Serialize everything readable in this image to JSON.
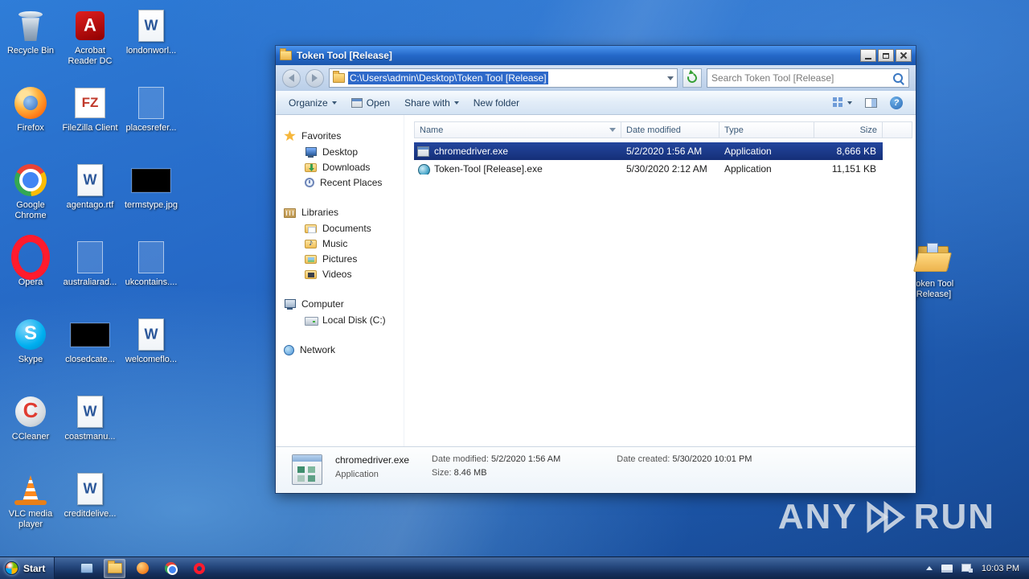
{
  "colors": {
    "selection": "#152f78",
    "titlebar": "#2468c8",
    "taskbar": "#1c3a6b",
    "desktop": "#1f5fb8"
  },
  "desktop": {
    "columns": [
      {
        "items": [
          {
            "label": "Recycle Bin",
            "icon": "recycle-bin"
          },
          {
            "label": "Firefox",
            "icon": "firefox"
          },
          {
            "label": "Google Chrome",
            "icon": "chrome"
          },
          {
            "label": "Opera",
            "icon": "opera"
          },
          {
            "label": "Skype",
            "icon": "skype"
          },
          {
            "label": "CCleaner",
            "icon": "ccleaner"
          },
          {
            "label": "VLC media player",
            "icon": "vlc"
          }
        ]
      },
      {
        "items": [
          {
            "label": "Acrobat Reader DC",
            "icon": "acrobat"
          },
          {
            "label": "FileZilla Client",
            "icon": "filezilla"
          },
          {
            "label": "agentago.rtf",
            "icon": "word-doc"
          },
          {
            "label": "australiarad...",
            "icon": "ghost-doc"
          },
          {
            "label": "closedcate...",
            "icon": "black-thumb"
          },
          {
            "label": "coastmanu...",
            "icon": "word-doc"
          },
          {
            "label": "creditdelive...",
            "icon": "word-doc"
          }
        ]
      },
      {
        "items": [
          {
            "label": "londonworl...",
            "icon": "word-doc"
          },
          {
            "label": "placesrefer...",
            "icon": "ghost-doc"
          },
          {
            "label": "termstype.jpg",
            "icon": "black-thumb"
          },
          {
            "label": "ukcontains....",
            "icon": "ghost-doc"
          },
          {
            "label": "welcomeflo...",
            "icon": "word-doc"
          }
        ]
      }
    ],
    "right_icon": {
      "label": "Token Tool [Release]",
      "icon": "folder-open"
    }
  },
  "window": {
    "title": "Token Tool [Release]",
    "address": {
      "path": "C:\\Users\\admin\\Desktop\\Token Tool [Release]"
    },
    "search": {
      "placeholder": "Search Token Tool [Release]"
    },
    "toolbar": {
      "organize": "Organize",
      "open": "Open",
      "share": "Share with",
      "new_folder": "New folder"
    },
    "sidebar": {
      "groups": [
        {
          "label": "Favorites",
          "icon": "star",
          "children": [
            {
              "label": "Desktop",
              "icon": "desktop"
            },
            {
              "label": "Downloads",
              "icon": "downloads"
            },
            {
              "label": "Recent Places",
              "icon": "recent"
            }
          ]
        },
        {
          "label": "Libraries",
          "icon": "library",
          "children": [
            {
              "label": "Documents",
              "icon": "documents"
            },
            {
              "label": "Music",
              "icon": "music"
            },
            {
              "label": "Pictures",
              "icon": "pictures"
            },
            {
              "label": "Videos",
              "icon": "videos"
            }
          ]
        },
        {
          "label": "Computer",
          "icon": "computer",
          "children": [
            {
              "label": "Local Disk (C:)",
              "icon": "disk"
            }
          ]
        },
        {
          "label": "Network",
          "icon": "network",
          "children": []
        }
      ]
    },
    "list": {
      "columns": [
        "Name",
        "Date modified",
        "Type",
        "Size"
      ],
      "rows": [
        {
          "name": "chromedriver.exe",
          "date": "5/2/2020 1:56 AM",
          "type": "Application",
          "size": "8,666 KB",
          "icon": "app-gray",
          "selected": true
        },
        {
          "name": "Token-Tool [Release].exe",
          "date": "5/30/2020 2:12 AM",
          "type": "Application",
          "size": "11,151 KB",
          "icon": "app-teal",
          "selected": false
        }
      ]
    },
    "details": {
      "file_name": "chromedriver.exe",
      "file_type": "Application",
      "modified_label": "Date modified:",
      "modified_value": "5/2/2020 1:56 AM",
      "size_label": "Size:",
      "size_value": "8.46 MB",
      "created_label": "Date created:",
      "created_value": "5/30/2020 10:01 PM"
    }
  },
  "taskbar": {
    "start_label": "Start",
    "clock": "10:03 PM"
  },
  "watermark": {
    "left": "ANY",
    "right": "RUN"
  }
}
